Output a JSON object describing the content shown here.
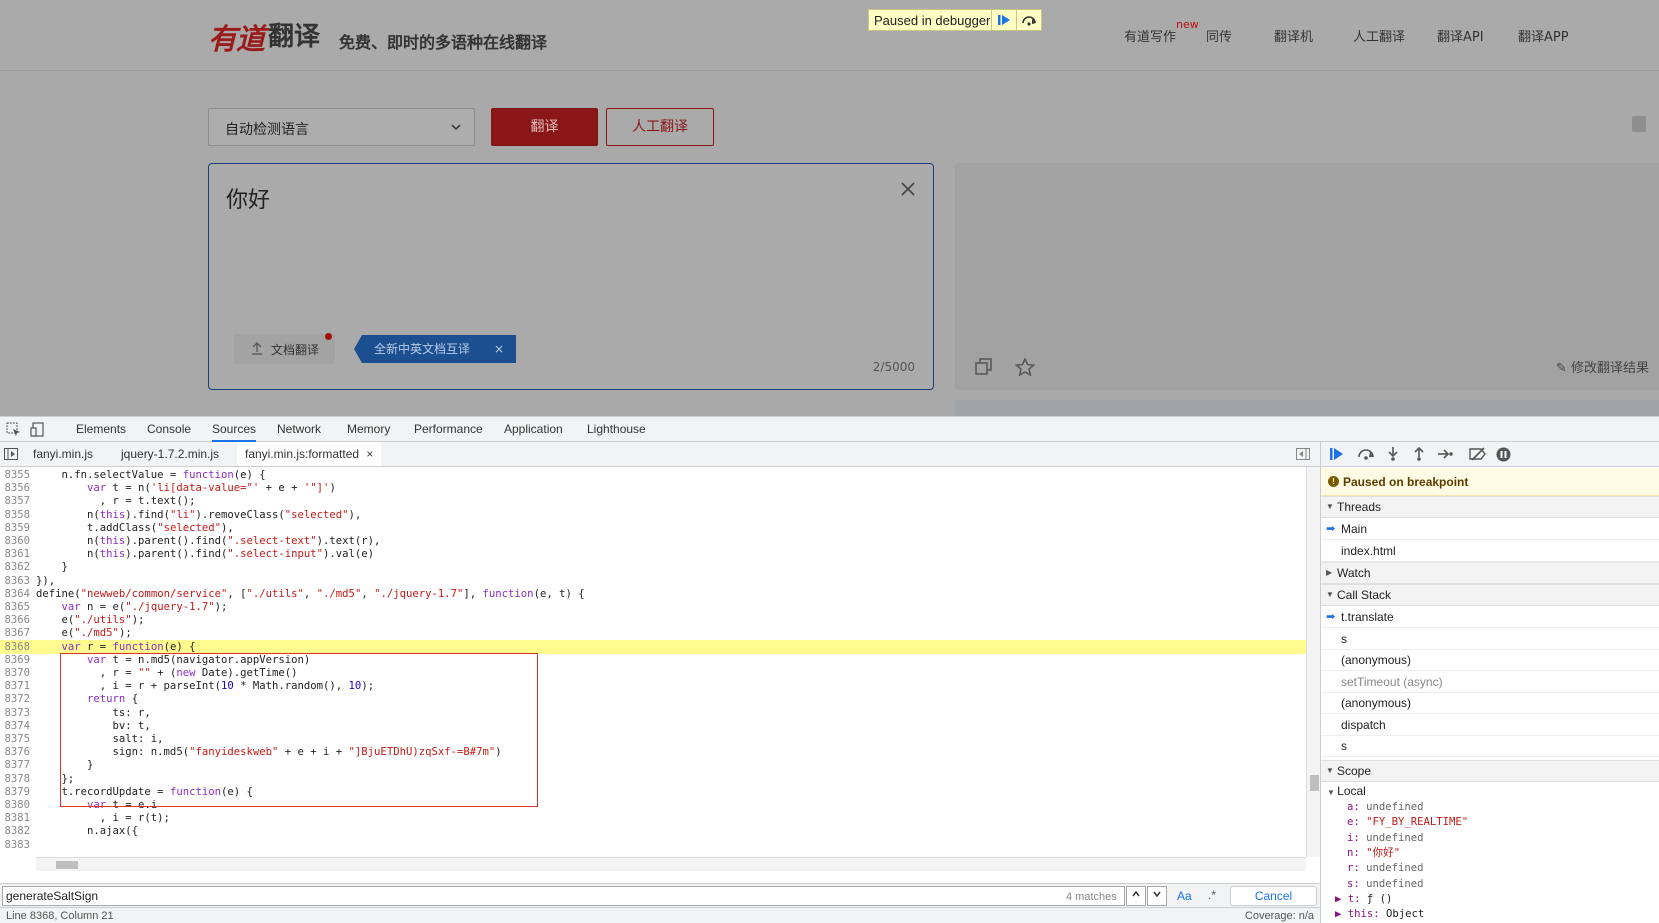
{
  "header": {
    "logo": "有道",
    "logo_suffix": "翻译",
    "slogan": "免费、即时的多语种在线翻译",
    "nav": [
      {
        "label": "有道写作",
        "badge": "new"
      },
      {
        "label": "同传"
      },
      {
        "label": "翻译机"
      },
      {
        "label": "人工翻译"
      },
      {
        "label": "翻译API"
      },
      {
        "label": "翻译APP"
      }
    ]
  },
  "debugger_badge": {
    "label": "Paused in debugger"
  },
  "translator": {
    "lang_select": "自动检测语言",
    "translate_btn": "翻译",
    "human_btn": "人工翻译",
    "input_text": "你好",
    "doc_btn": "文档翻译",
    "promo": "全新中英文档互译",
    "promo_close": "×",
    "char_count": "2/5000",
    "edit_result": "修改翻译结果"
  },
  "devtools": {
    "tabs": [
      "Elements",
      "Console",
      "Sources",
      "Network",
      "Memory",
      "Performance",
      "Application",
      "Lighthouse"
    ],
    "active_tab": "Sources",
    "file_tabs": [
      "fanyi.min.js",
      "jquery-1.7.2.min.js",
      "fanyi.min.js:formatted"
    ],
    "close_glyph": "×",
    "code": [
      {
        "n": "8355",
        "t": "    n.fn.selectValue = function(e) {"
      },
      {
        "n": "8356",
        "t": "        var t = n('li[data-value=\"' + e + '\"]')"
      },
      {
        "n": "8357",
        "t": "          , r = t.text();"
      },
      {
        "n": "8358",
        "t": "        n(this).find(\"li\").removeClass(\"selected\"),"
      },
      {
        "n": "8359",
        "t": "        t.addClass(\"selected\"),"
      },
      {
        "n": "8360",
        "t": "        n(this).parent().find(\".select-text\").text(r),"
      },
      {
        "n": "8361",
        "t": "        n(this).parent().find(\".select-input\").val(e)"
      },
      {
        "n": "8362",
        "t": "    }"
      },
      {
        "n": "8363",
        "t": "}),"
      },
      {
        "n": "8364",
        "t": "define(\"newweb/common/service\", [\"./utils\", \"./md5\", \"./jquery-1.7\"], function(e, t) {"
      },
      {
        "n": "8365",
        "t": "    var n = e(\"./jquery-1.7\");"
      },
      {
        "n": "8366",
        "t": "    e(\"./utils\");"
      },
      {
        "n": "8367",
        "t": "    e(\"./md5\");"
      },
      {
        "n": "8368",
        "t": "    var r = function(e) {"
      },
      {
        "n": "8369",
        "t": "        var t = n.md5(navigator.appVersion)"
      },
      {
        "n": "8370",
        "t": "          , r = \"\" + (new Date).getTime()"
      },
      {
        "n": "8371",
        "t": "          , i = r + parseInt(10 * Math.random(), 10);"
      },
      {
        "n": "8372",
        "t": "        return {"
      },
      {
        "n": "8373",
        "t": "            ts: r,"
      },
      {
        "n": "8374",
        "t": "            bv: t,"
      },
      {
        "n": "8375",
        "t": "            salt: i,"
      },
      {
        "n": "8376",
        "t": "            sign: n.md5(\"fanyideskweb\" + e + i + \"]BjuETDhU)zqSxf-=B#7m\")"
      },
      {
        "n": "8377",
        "t": "        }"
      },
      {
        "n": "8378",
        "t": "    };"
      },
      {
        "n": "8379",
        "t": "    t.recordUpdate = function(e) {"
      },
      {
        "n": "8380",
        "t": "        var t = e.i"
      },
      {
        "n": "8381",
        "t": "          , i = r(t);"
      },
      {
        "n": "8382",
        "t": "        n.ajax({"
      }
    ],
    "last_line_number": "8383",
    "highlight_line": "8368",
    "search": {
      "value": "generateSaltSign",
      "matches": "4 matches",
      "aa": "Aa",
      "regex": ".*",
      "cancel": "Cancel"
    },
    "status": {
      "position": "Line 8368, Column 21",
      "coverage": "Coverage: n/a"
    },
    "debugger": {
      "paused": "Paused on breakpoint",
      "threads_label": "Threads",
      "threads": [
        "Main",
        "index.html"
      ],
      "watch_label": "Watch",
      "callstack_label": "Call Stack",
      "callstack": [
        {
          "label": "t.translate",
          "current": true
        },
        {
          "label": "s"
        },
        {
          "label": "(anonymous)"
        },
        {
          "label": "setTimeout (async)",
          "async": true
        },
        {
          "label": "(anonymous)"
        },
        {
          "label": "dispatch"
        },
        {
          "label": "s"
        }
      ],
      "scope_label": "Scope",
      "local_label": "Local",
      "scope_vars": [
        {
          "k": "a",
          "v": "undefined",
          "type": "u"
        },
        {
          "k": "e",
          "v": "\"FY_BY_REALTIME\"",
          "type": "s"
        },
        {
          "k": "i",
          "v": "undefined",
          "type": "u"
        },
        {
          "k": "n",
          "v": "\"你好\"",
          "type": "s"
        },
        {
          "k": "r",
          "v": "undefined",
          "type": "u"
        },
        {
          "k": "s",
          "v": "undefined",
          "type": "u"
        },
        {
          "k": "t",
          "v": "ƒ ()",
          "type": "f"
        },
        {
          "k": "this",
          "v": "Object",
          "type": "o"
        }
      ]
    }
  }
}
